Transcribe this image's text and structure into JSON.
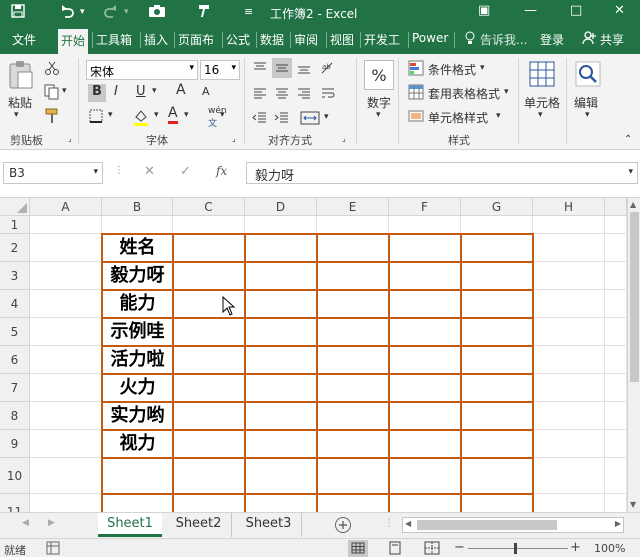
{
  "titlebar": {
    "title": "工作簿2 - Excel",
    "qa_save_icon": "save-icon",
    "qa_undo_icon": "undo-icon",
    "qa_redo_icon": "redo-icon",
    "qa_camera_icon": "camera-icon",
    "qa_format_icon": "format-painter-icon",
    "qa_customize_icon": "customize-quick-access-icon",
    "minimize": "—",
    "maximize": "□",
    "close": "✕",
    "restore": "▣"
  },
  "menubar": {
    "tabs": [
      {
        "label": "文件"
      },
      {
        "label": "开始"
      },
      {
        "label": "工具箱"
      },
      {
        "label": "插入"
      },
      {
        "label": "页面布"
      },
      {
        "label": "公式"
      },
      {
        "label": "数据"
      },
      {
        "label": "审阅"
      },
      {
        "label": "视图"
      },
      {
        "label": "开发工"
      },
      {
        "label": "Power"
      }
    ],
    "tell_me": "告诉我...",
    "login": "登录",
    "share": "共享"
  },
  "ribbon": {
    "clipboard": {
      "label": "剪贴板",
      "paste": "粘贴"
    },
    "font": {
      "label": "字体",
      "font_name": "宋体",
      "font_size": "16",
      "bold": "B",
      "italic": "I",
      "underline": "U",
      "grow": "A",
      "shrink": "A",
      "font_color": "A",
      "phonetic": "wén"
    },
    "alignment": {
      "label": "对齐方式"
    },
    "number": {
      "label": "数字",
      "symbol": "%"
    },
    "styles": {
      "label": "样式",
      "conditional": "条件格式",
      "table": "套用表格格式",
      "cell_style": "单元格样式"
    },
    "cells": {
      "label": "单元格"
    },
    "editing": {
      "label": "编辑"
    }
  },
  "formula_bar": {
    "name_box": "B3",
    "fx": "fx",
    "formula": "毅力呀"
  },
  "sheet": {
    "columns": [
      "A",
      "B",
      "C",
      "D",
      "E",
      "F",
      "G",
      "H"
    ],
    "rows": [
      "1",
      "2",
      "3",
      "4",
      "5",
      "6",
      "7",
      "8",
      "9",
      "10",
      "11"
    ],
    "b_values": [
      "",
      "姓名",
      "毅力呀",
      "能力",
      "示例哇",
      "活力啦",
      "火力",
      "实力哟",
      "视力",
      "",
      ""
    ]
  },
  "sheet_tabs": [
    "Sheet1",
    "Sheet2",
    "Sheet3"
  ],
  "status": {
    "ready": "就绪",
    "zoom": "100%",
    "minus": "−",
    "plus": "+"
  }
}
